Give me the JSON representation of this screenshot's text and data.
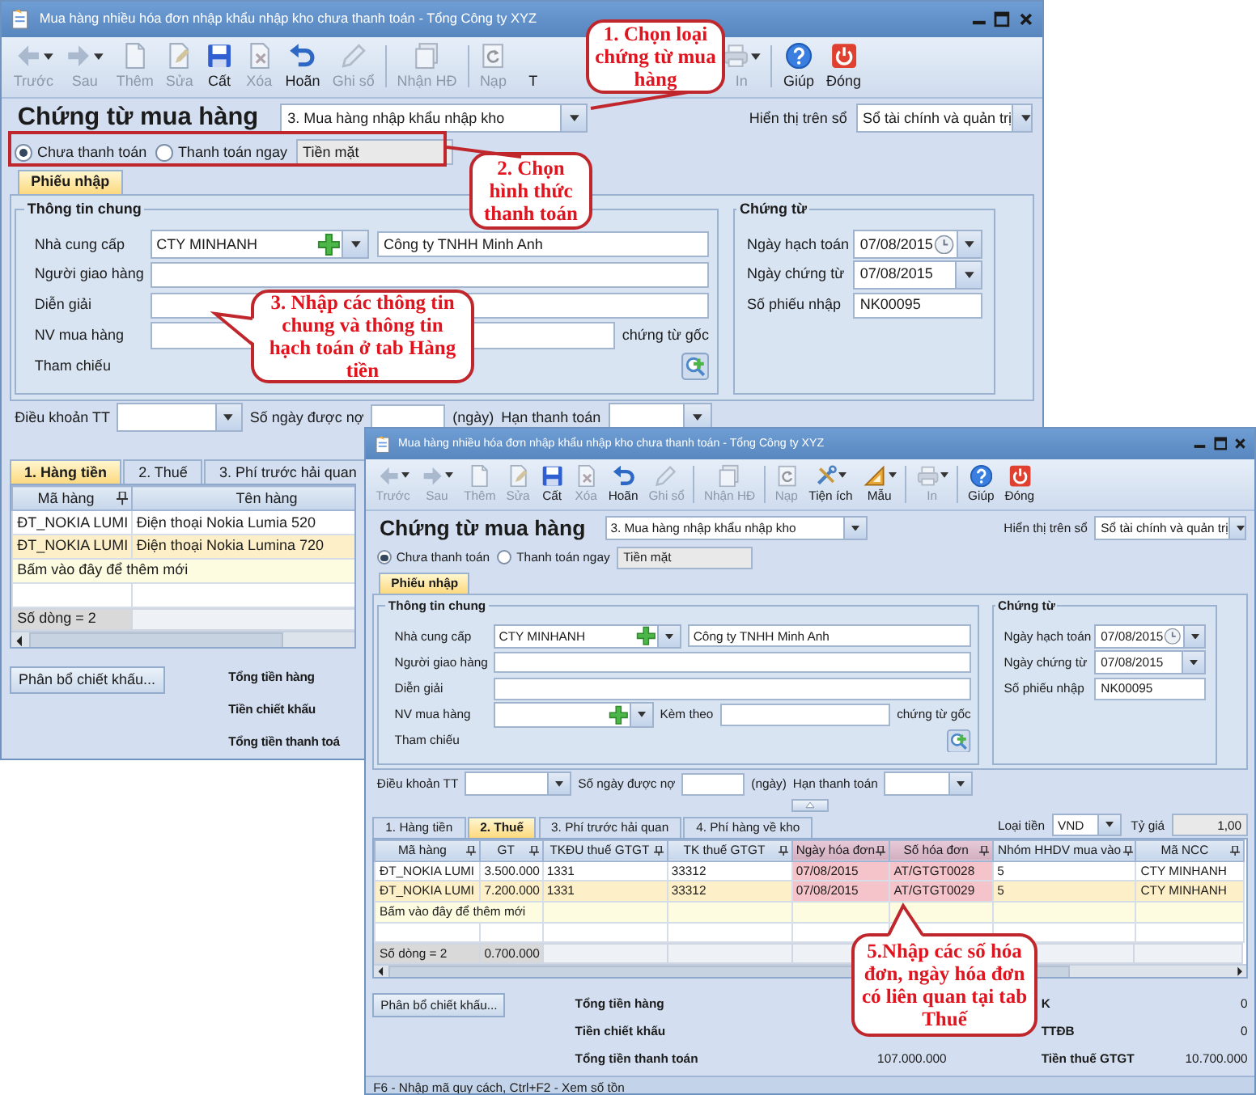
{
  "windows": [
    {
      "title": "Mua hàng nhiều hóa đơn nhập khẩu nhập kho chưa thanh toán - Tổng Công ty XYZ",
      "toolbar": [
        {
          "label": "Trước",
          "kind": "back",
          "disabled": true,
          "dropdown": true,
          "separator_before": false
        },
        {
          "label": "Sau",
          "kind": "forward",
          "disabled": true,
          "dropdown": true,
          "separator_before": false
        },
        {
          "label": "Thêm",
          "kind": "add",
          "disabled": true,
          "dropdown": false,
          "separator_before": false
        },
        {
          "label": "Sửa",
          "kind": "edit",
          "disabled": true,
          "dropdown": false,
          "separator_before": false
        },
        {
          "label": "Cất",
          "kind": "save",
          "disabled": false,
          "dropdown": false,
          "separator_before": false
        },
        {
          "label": "Xóa",
          "kind": "delete",
          "disabled": true,
          "dropdown": false,
          "separator_before": false
        },
        {
          "label": "Hoãn",
          "kind": "undo",
          "disabled": false,
          "dropdown": false,
          "separator_before": false
        },
        {
          "label": "Ghi sổ",
          "kind": "pencil",
          "disabled": true,
          "dropdown": false,
          "separator_before": false
        },
        {
          "label": "Nhận HĐ",
          "kind": "invoice",
          "disabled": true,
          "dropdown": false,
          "separator_before": true
        },
        {
          "label": "Nạp",
          "kind": "reload",
          "disabled": true,
          "dropdown": false,
          "separator_before": true
        },
        {
          "label": "T",
          "kind": "none",
          "disabled": false,
          "dropdown": false,
          "separator_before": false
        },
        {
          "label": "In",
          "kind": "print",
          "disabled": true,
          "dropdown": true,
          "separator_before": false
        },
        {
          "label": "Giúp",
          "kind": "help",
          "disabled": false,
          "dropdown": false,
          "separator_before": true
        },
        {
          "label": "Đóng",
          "kind": "close",
          "disabled": false,
          "dropdown": false,
          "separator_before": false
        }
      ],
      "heading": "Chứng từ mua hàng",
      "voucher_type": "3. Mua hàng nhập khẩu nhập kho",
      "book_label": "Hiển thị trên sổ",
      "book": "Sổ tài chính và quản trị",
      "payment_options": [
        {
          "label": "Chưa thanh toán",
          "selected": true
        },
        {
          "label": "Thanh toán ngay",
          "selected": false
        }
      ],
      "payment_method": "Tiền mặt",
      "form_tabs": [
        {
          "label": "Phiếu nhập",
          "selected": true
        }
      ],
      "general": {
        "title": "Thông tin chung",
        "rows": [
          {
            "kind": "lookup",
            "label": "Nhà cung cấp",
            "value": "CTY MINHANH",
            "name": "Công ty TNHH Minh Anh"
          },
          {
            "kind": "text",
            "label": "Người giao hàng"
          },
          {
            "kind": "text",
            "label": "Diễn giải"
          },
          {
            "kind": "text_suffix",
            "label": "NV mua hàng",
            "suffix": "chứng từ gốc"
          },
          {
            "kind": "reference",
            "label": "Tham chiếu"
          }
        ]
      },
      "voucher": {
        "title": "Chứng từ",
        "rows": [
          {
            "kind": "date_clock",
            "label": "Ngày hạch toán",
            "value": "07/08/2015"
          },
          {
            "kind": "date",
            "label": "Ngày chứng từ",
            "value": "07/08/2015"
          },
          {
            "kind": "text",
            "label": "Số phiếu nhập",
            "value": "NK00095"
          }
        ]
      },
      "terms": {
        "payment_terms_label": "Điều khoản TT",
        "days_label": "Số ngày được nợ",
        "days_unit": "(ngày)",
        "due_label": "Hạn thanh toán"
      },
      "detail_tabs": [
        {
          "label": "1. Hàng tiền",
          "selected": true
        },
        {
          "label": "2. Thuế",
          "selected": false
        },
        {
          "label": "3. Phí trước hải quan",
          "selected": false
        }
      ],
      "grid": {
        "columns": [
          {
            "label": "Mã hàng",
            "pinned": true,
            "annotated": false
          },
          {
            "label": "Tên hàng",
            "pinned": false,
            "annotated": false
          }
        ],
        "rows": [
          {
            "cells": [
              "ĐT_NOKIA LUMI",
              "Điện thoại Nokia Lumia 520"
            ],
            "selected": false
          },
          {
            "cells": [
              "ĐT_NOKIA LUMI",
              "Điện thoại Nokia Lumina 720"
            ],
            "selected": true
          }
        ],
        "new_row": "Bấm vào đây để thêm mới",
        "footer": [
          "Số dòng = 2"
        ]
      },
      "allocate_button": "Phân bổ chiết khấu...",
      "totals": [
        {
          "label": "Tổng tiền hàng"
        },
        {
          "label": "Tiền chiết khấu"
        },
        {
          "label": "Tổng tiền thanh toá"
        }
      ]
    },
    {
      "title": "Mua hàng nhiều hóa đơn nhập khẩu nhập kho chưa thanh toán - Tổng Công ty XYZ",
      "toolbar": [
        {
          "label": "Trước",
          "kind": "back",
          "disabled": true,
          "dropdown": true,
          "separator_before": false
        },
        {
          "label": "Sau",
          "kind": "forward",
          "disabled": true,
          "dropdown": true,
          "separator_before": false
        },
        {
          "label": "Thêm",
          "kind": "add",
          "disabled": true,
          "dropdown": false,
          "separator_before": false
        },
        {
          "label": "Sửa",
          "kind": "edit",
          "disabled": true,
          "dropdown": false,
          "separator_before": false
        },
        {
          "label": "Cất",
          "kind": "save",
          "disabled": false,
          "dropdown": false,
          "separator_before": false
        },
        {
          "label": "Xóa",
          "kind": "delete",
          "disabled": true,
          "dropdown": false,
          "separator_before": false
        },
        {
          "label": "Hoãn",
          "kind": "undo",
          "disabled": false,
          "dropdown": false,
          "separator_before": false
        },
        {
          "label": "Ghi sổ",
          "kind": "pencil",
          "disabled": true,
          "dropdown": false,
          "separator_before": false
        },
        {
          "label": "Nhận HĐ",
          "kind": "invoice",
          "disabled": true,
          "dropdown": false,
          "separator_before": true
        },
        {
          "label": "Nạp",
          "kind": "reload",
          "disabled": true,
          "dropdown": false,
          "separator_before": true
        },
        {
          "label": "Tiện ích",
          "kind": "tools",
          "disabled": false,
          "dropdown": true,
          "separator_before": false
        },
        {
          "label": "Mẫu",
          "kind": "template",
          "disabled": false,
          "dropdown": true,
          "separator_before": false
        },
        {
          "label": "In",
          "kind": "print",
          "disabled": true,
          "dropdown": true,
          "separator_before": true
        },
        {
          "label": "Giúp",
          "kind": "help",
          "disabled": false,
          "dropdown": false,
          "separator_before": true
        },
        {
          "label": "Đóng",
          "kind": "close",
          "disabled": false,
          "dropdown": false,
          "separator_before": false
        }
      ],
      "heading": "Chứng từ mua hàng",
      "voucher_type": "3. Mua hàng nhập khẩu nhập kho",
      "book_label": "Hiển thị trên sổ",
      "book": "Sổ tài chính và quản trị",
      "payment_options": [
        {
          "label": "Chưa thanh toán",
          "selected": true
        },
        {
          "label": "Thanh toán ngay",
          "selected": false
        }
      ],
      "payment_method": "Tiền mặt",
      "form_tabs": [
        {
          "label": "Phiếu nhập",
          "selected": true
        }
      ],
      "general": {
        "title": "Thông tin chung",
        "rows": [
          {
            "kind": "lookup",
            "label": "Nhà cung cấp",
            "value": "CTY MINHANH",
            "name": "Công ty TNHH Minh Anh"
          },
          {
            "kind": "text",
            "label": "Người giao hàng"
          },
          {
            "kind": "text",
            "label": "Diễn giải"
          },
          {
            "kind": "employee",
            "label": "NV mua hàng",
            "attach_label": "Kèm theo",
            "suffix": "chứng từ gốc"
          },
          {
            "kind": "reference",
            "label": "Tham chiếu"
          }
        ]
      },
      "voucher": {
        "title": "Chứng từ",
        "rows": [
          {
            "kind": "date_clock",
            "label": "Ngày hạch toán",
            "value": "07/08/2015"
          },
          {
            "kind": "date",
            "label": "Ngày chứng từ",
            "value": "07/08/2015"
          },
          {
            "kind": "text",
            "label": "Số phiếu nhập",
            "value": "NK00095"
          }
        ]
      },
      "terms": {
        "payment_terms_label": "Điều khoản TT",
        "days_label": "Số ngày được nợ",
        "days_unit": "(ngày)",
        "due_label": "Hạn thanh toán"
      },
      "panel_collapsible": true,
      "detail_tabs": [
        {
          "label": "1. Hàng tiền",
          "selected": false
        },
        {
          "label": "2. Thuế",
          "selected": true
        },
        {
          "label": "3. Phí trước hải quan",
          "selected": false
        },
        {
          "label": "4. Phí hàng về kho",
          "selected": false
        }
      ],
      "currency": {
        "label": "Loại tiền",
        "value": "VND",
        "rate_label": "Tỷ giá",
        "rate": "1,00"
      },
      "grid": {
        "columns": [
          {
            "label": "Mã hàng",
            "pinned": true,
            "annotated": false
          },
          {
            "label": "GT",
            "pinned": true,
            "annotated": false
          },
          {
            "label": "TKĐU thuế GTGT",
            "pinned": true,
            "annotated": false
          },
          {
            "label": "TK thuế GTGT",
            "pinned": true,
            "annotated": false
          },
          {
            "label": "Ngày hóa đơn",
            "pinned": true,
            "annotated": true
          },
          {
            "label": "Số hóa đơn",
            "pinned": true,
            "annotated": true
          },
          {
            "label": "Nhóm HHDV mua vào",
            "pinned": true,
            "annotated": false
          },
          {
            "label": "Mã NCC",
            "pinned": true,
            "annotated": false
          }
        ],
        "rows": [
          {
            "cells": [
              "ĐT_NOKIA LUMI",
              "3.500.000",
              "1331",
              "33312",
              "07/08/2015",
              "AT/GTGT0028",
              "5",
              "CTY MINHANH"
            ],
            "selected": false
          },
          {
            "cells": [
              "ĐT_NOKIA LUMI",
              "7.200.000",
              "1331",
              "33312",
              "07/08/2015",
              "AT/GTGT0029",
              "5",
              "CTY MINHANH"
            ],
            "selected": true
          }
        ],
        "new_row": "Bấm vào đây để thêm mới",
        "footer": [
          "Số dòng = 2",
          "0.700.000"
        ]
      },
      "allocate_button": "Phân bổ chiết khấu...",
      "totals": [
        {
          "label": "Tổng tiền hàng"
        },
        {
          "label": "Tiền chiết khấu"
        },
        {
          "label": "Tổng tiền thanh toán",
          "value": "107.000.000"
        }
      ],
      "totals_right": [
        {
          "label": "K",
          "value": "0"
        },
        {
          "label": "TTĐB",
          "value": "0"
        },
        {
          "label": "Tiền thuế GTGT",
          "value": "10.700.000"
        }
      ],
      "status": "F6 - Nhập mã quy cách, Ctrl+F2 - Xem số tồn"
    }
  ],
  "annotations": [
    {
      "kind": "callout",
      "text": "1. Chọn loại chứng từ mua hàng"
    },
    {
      "kind": "callout",
      "text": "2. Chọn hình thức thanh toán"
    },
    {
      "kind": "callout",
      "text": "3. Nhập các thông tin chung và thông tin hạch toán ở tab Hàng tiền"
    },
    {
      "kind": "callout",
      "text": "5.Nhập các số hóa đơn, ngày hóa đơn có liên quan tại tab Thuế"
    },
    {
      "kind": "frame"
    }
  ]
}
